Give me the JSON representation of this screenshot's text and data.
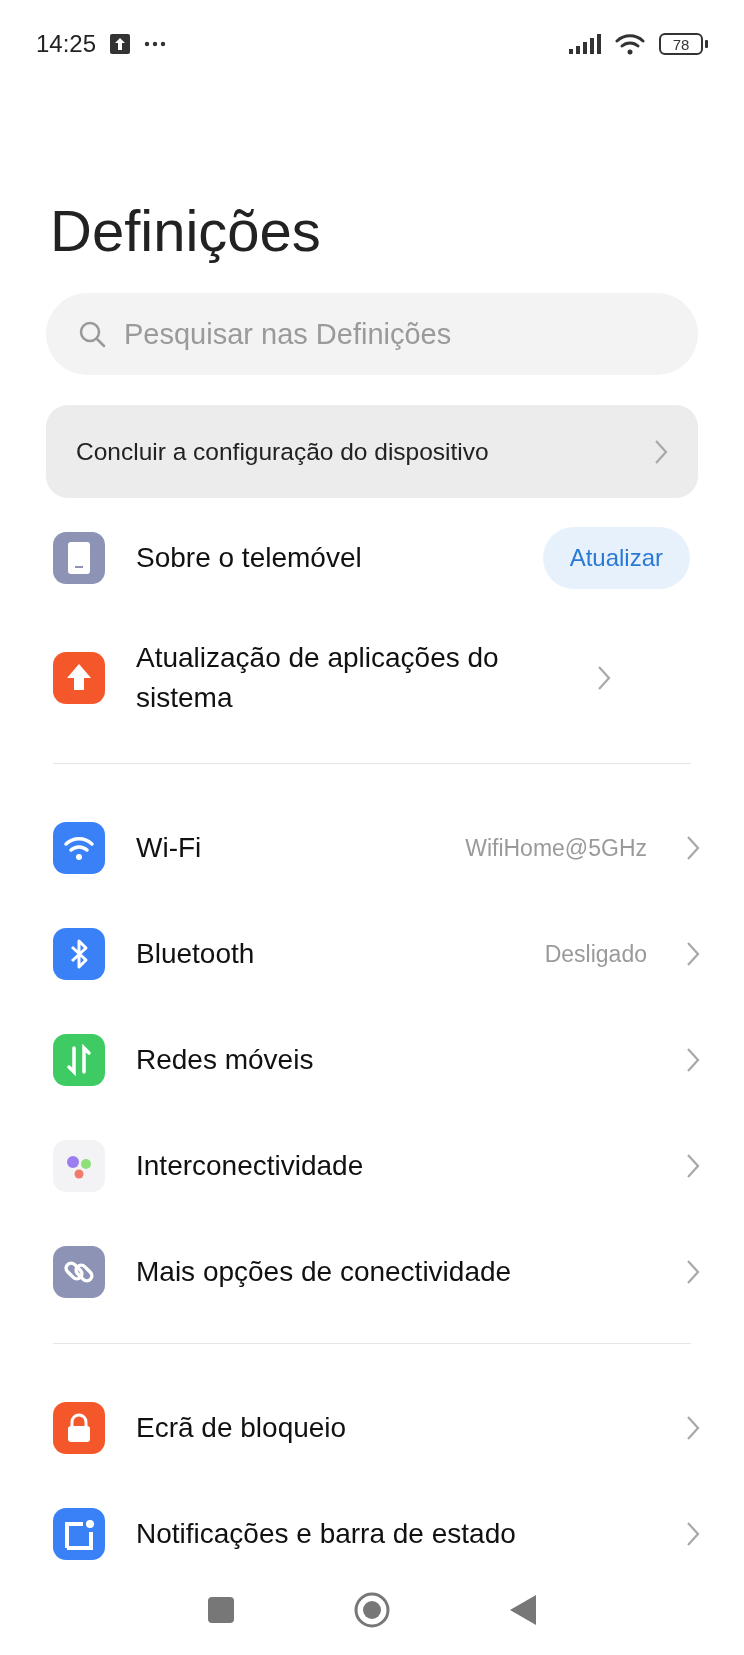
{
  "status_bar": {
    "time": "14:25",
    "battery": "78"
  },
  "title": "Definições",
  "search": {
    "placeholder": "Pesquisar nas Definições"
  },
  "setup_card": {
    "label": "Concluir a configuração do dispositivo"
  },
  "sections": [
    {
      "items": [
        {
          "label": "Sobre o telemóvel",
          "color": "#8c93b4",
          "action_label": "Atualizar"
        },
        {
          "label": "Atualização de aplicações do sistema",
          "color": "#f4572a"
        }
      ]
    },
    {
      "items": [
        {
          "label": "Wi-Fi",
          "color": "#3a80f6",
          "value": "WifiHome@5GHz"
        },
        {
          "label": "Bluetooth",
          "color": "#3a80f6",
          "value": "Desligado"
        },
        {
          "label": "Redes móveis",
          "color": "#3ecb63"
        },
        {
          "label": "Interconectividade",
          "color": "#f3f3f5"
        },
        {
          "label": "Mais opções de conectividade",
          "color": "#8c93b4"
        }
      ]
    },
    {
      "items": [
        {
          "label": "Ecrã de bloqueio",
          "color": "#f4572a"
        },
        {
          "label": "Notificações e barra de estado",
          "color": "#3a80f6"
        }
      ]
    }
  ]
}
